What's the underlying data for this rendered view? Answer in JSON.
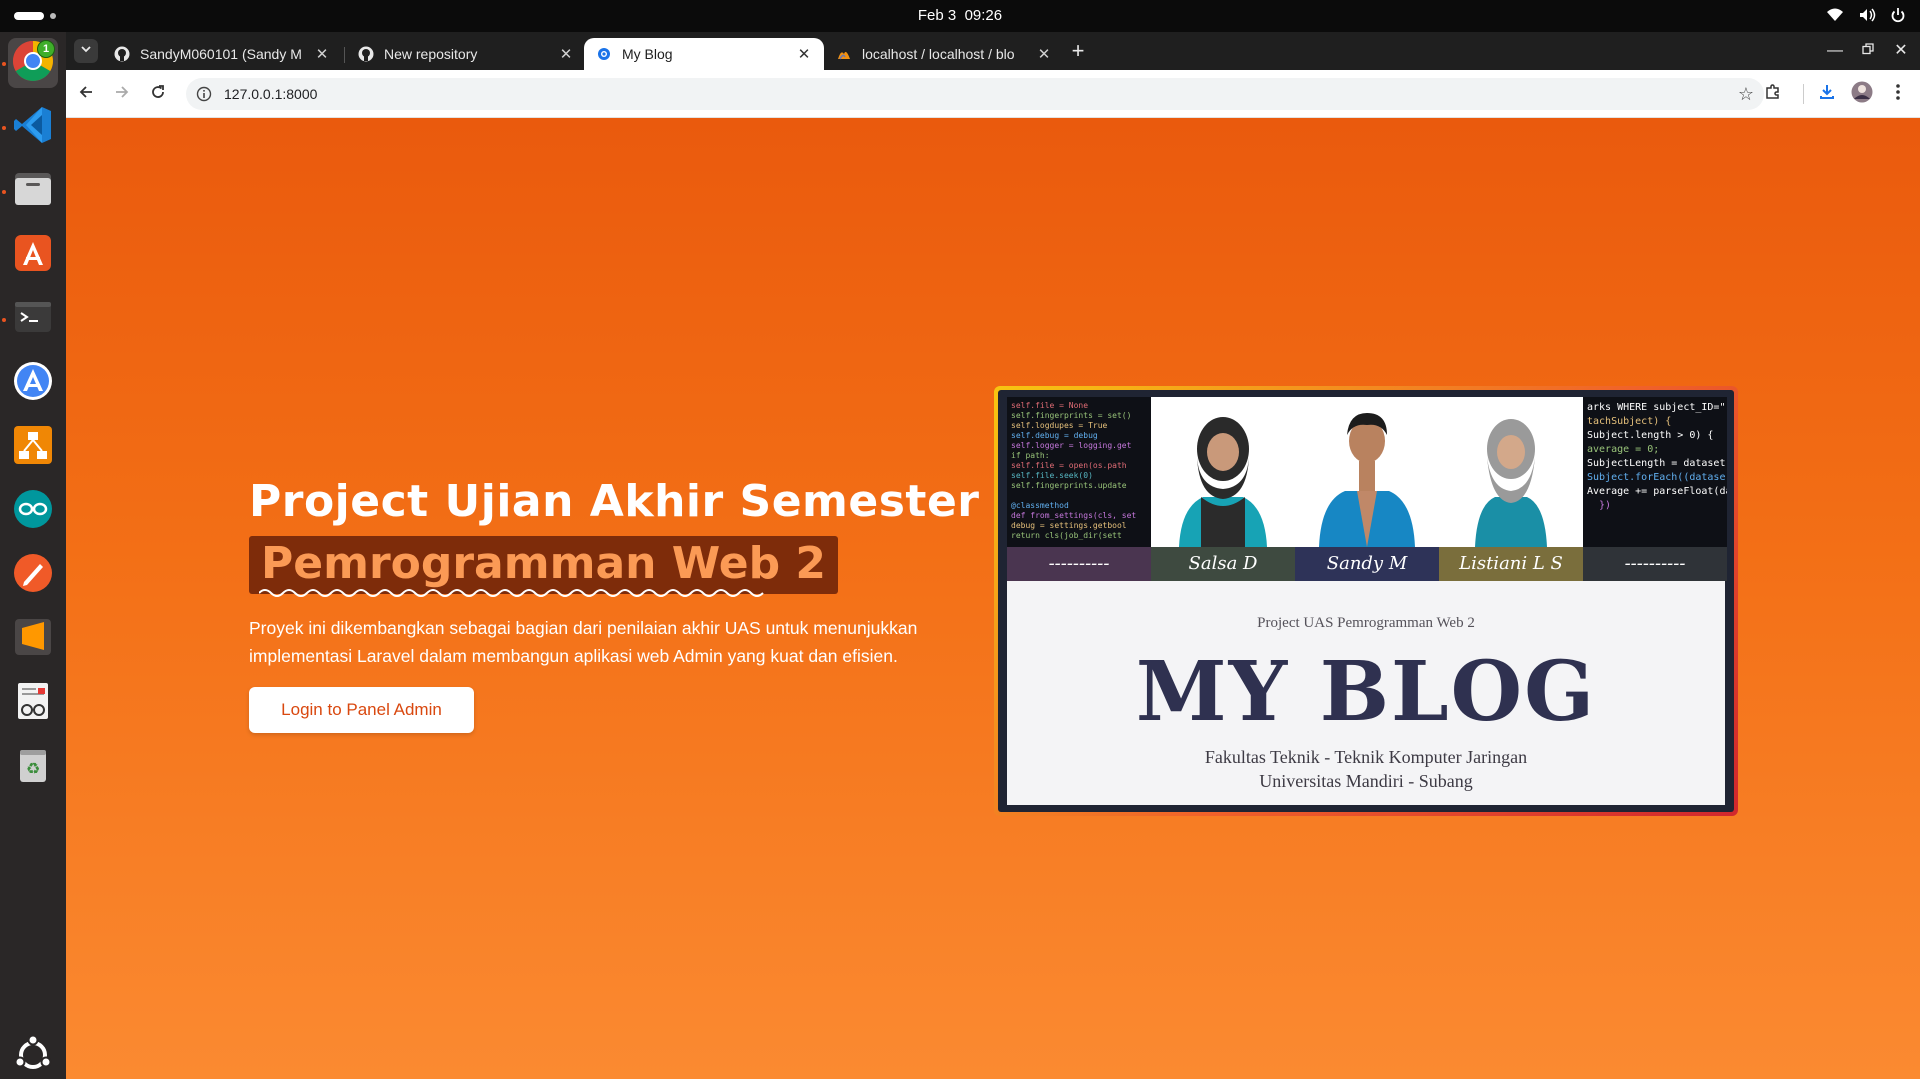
{
  "topbar": {
    "date": "Feb 3",
    "time": "09:26"
  },
  "dock": {
    "items": [
      {
        "name": "Google Chrome",
        "icon": "chrome-icon",
        "badge": "1"
      },
      {
        "name": "Visual Studio Code",
        "icon": "vscode-icon"
      },
      {
        "name": "Files",
        "icon": "files-icon"
      },
      {
        "name": "App Center",
        "icon": "app-center-icon"
      },
      {
        "name": "Terminal",
        "icon": "terminal-icon"
      },
      {
        "name": "Android Studio",
        "icon": "android-studio-icon"
      },
      {
        "name": "Diagram Editor",
        "icon": "diagram-icon"
      },
      {
        "name": "Arduino IDE",
        "icon": "arduino-icon"
      },
      {
        "name": "Design Tool",
        "icon": "pen-icon"
      },
      {
        "name": "Sublime Text",
        "icon": "sublime-icon"
      },
      {
        "name": "Document Viewer",
        "icon": "document-viewer-icon"
      },
      {
        "name": "Trash",
        "icon": "trash-icon"
      },
      {
        "name": "Show Apps",
        "icon": "ubuntu-logo-icon"
      }
    ]
  },
  "browser": {
    "tabs": [
      {
        "title": "SandyM060101 (Sandy M",
        "favicon": "github-icon",
        "active": false
      },
      {
        "title": "New repository",
        "favicon": "github-icon",
        "active": false
      },
      {
        "title": "My Blog",
        "favicon": "globe-icon",
        "active": true
      },
      {
        "title": "localhost / localhost / blo",
        "favicon": "phpmyadmin-icon",
        "active": false
      }
    ],
    "new_tab_label": "+",
    "url": "127.0.0.1:8000"
  },
  "page": {
    "hero": {
      "title": "Project Ujian Akhir Semester",
      "highlight": "Pemrogramman Web 2",
      "description": "Proyek ini dikembangkan sebagai bagian dari penilaian akhir UAS untuk menunjukkan implementasi Laravel dalam membangun aplikasi web Admin yang kuat dan efisien.",
      "button_label": "Login to Panel Admin"
    },
    "card": {
      "name_bar": [
        {
          "text": "----------",
          "color": "#4a3550"
        },
        {
          "text": "Salsa D",
          "color": "#3e4a40"
        },
        {
          "text": "Sandy M",
          "color": "#2e3358"
        },
        {
          "text": "Listiani L S",
          "color": "#7a6e3c"
        },
        {
          "text": "----------",
          "color": "#2f3338"
        }
      ],
      "subtitle": "Project UAS Pemrogramman Web 2",
      "title": "MY BLOG",
      "faculty": "Fakultas Teknik - Teknik Komputer Jaringan",
      "university": "Universitas Mandiri - Subang"
    }
  },
  "colors": {
    "page_gradient_top": "#ea5a0d",
    "page_gradient_bottom": "#fb8a31",
    "accent_button_text": "#d9480f",
    "highlight_bg": "#7e2c0a",
    "highlight_text": "#fb9a55"
  }
}
